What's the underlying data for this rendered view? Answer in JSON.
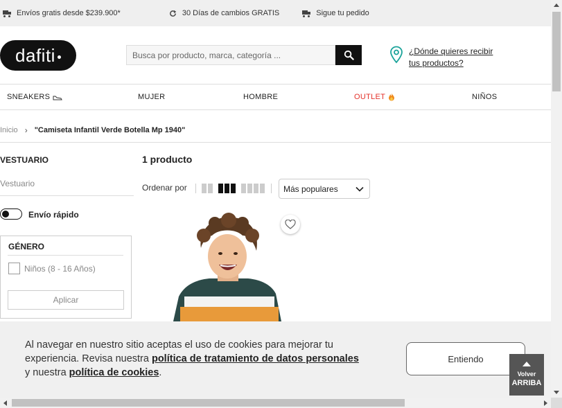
{
  "topbar": {
    "shipping": "Envíos gratis desde $239.900*",
    "returns": "30 Días de cambios GRATIS",
    "tracking": "Sigue tu pedido"
  },
  "header": {
    "logo": "dafiti",
    "search_placeholder": "Busca por producto, marca, categoría ...",
    "location_line1": "¿Dónde quieres recibir",
    "location_line2": "tus productos?"
  },
  "nav": {
    "items": [
      {
        "label": "SNEAKERS"
      },
      {
        "label": "MUJER"
      },
      {
        "label": "HOMBRE"
      },
      {
        "label": "OUTLET"
      },
      {
        "label": "NIÑOS"
      }
    ]
  },
  "breadcrumb": {
    "home": "Inicio",
    "separator": "›",
    "current": "\"Camiseta Infantil Verde Botella Mp 1940\""
  },
  "sidebar": {
    "title": "VESTUARIO",
    "subtitle": "Vestuario",
    "fast_shipping": "Envío rápido",
    "gender_title": "GÉNERO",
    "gender_option": "Niños (8 - 16 Años)",
    "apply": "Aplicar"
  },
  "main": {
    "count": "1 producto",
    "sort_label": "Ordenar por",
    "sort_selected": "Más populares"
  },
  "cookie": {
    "text1": "Al navegar en nuestro sitio aceptas el uso de cookies para mejorar tu experiencia. Revisa nuestra ",
    "link1": "política de tratamiento de datos personales",
    "text2": " y nuestra ",
    "link2": "política de cookies",
    "text3": ".",
    "accept": "Entiendo"
  },
  "back_to_top": {
    "line1": "Volver",
    "line2": "ARRIBA"
  },
  "colors": {
    "outlet": "#e4322b",
    "logo_bg": "#111111",
    "location_icon": "#1aa39a"
  }
}
